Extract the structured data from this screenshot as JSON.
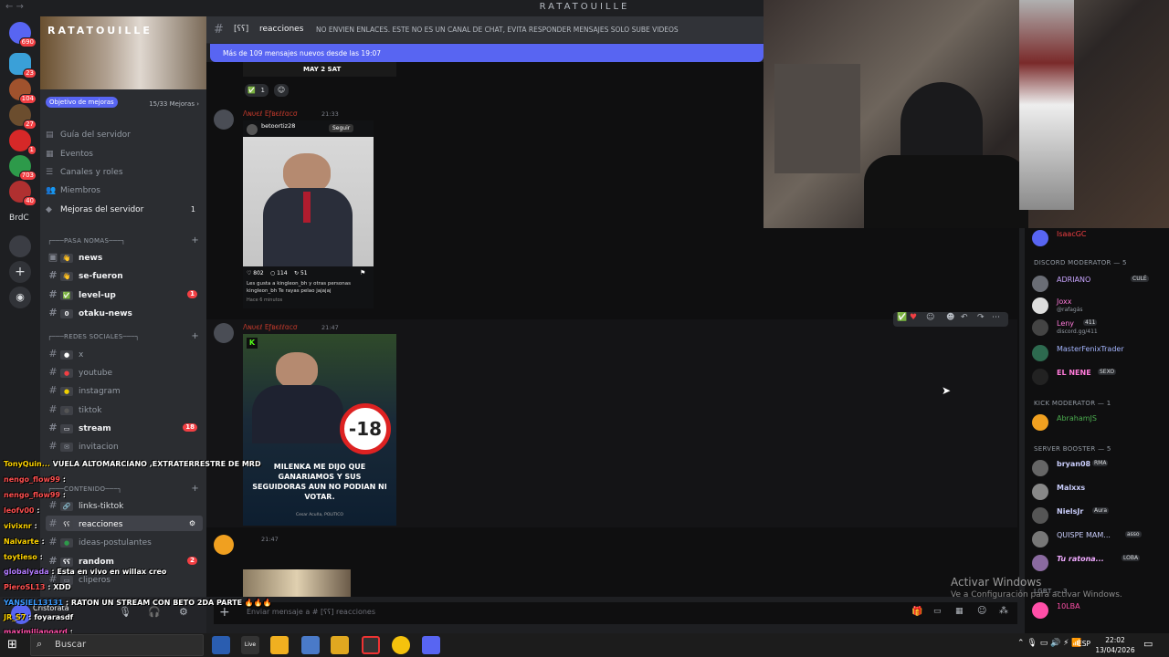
{
  "window": {
    "title": "RATATOUILLE",
    "nav": "←  →"
  },
  "server": {
    "name": "RATATOUILLE",
    "goal_label": "Objetivo de mejoras",
    "goal_count": "15/33 Mejoras ›"
  },
  "rail": {
    "badges": [
      "690",
      "23",
      "104",
      "27",
      "1",
      "703",
      "40"
    ],
    "label_brdc": "BrdC"
  },
  "server_menu": [
    {
      "label": "Guía del servidor"
    },
    {
      "label": "Eventos"
    },
    {
      "label": "Canales y roles"
    },
    {
      "label": "Miembros"
    },
    {
      "label": "Mejoras del servidor",
      "count": "1"
    }
  ],
  "categories": {
    "pasa": "┌───PASA NOMAS───┐",
    "redes": "┌───REDES SOCIALES───┐",
    "contenido": "┌───CONTENIDO───┐"
  },
  "channels": [
    {
      "name": "news",
      "emoji": "👋"
    },
    {
      "name": "se-fueron",
      "emoji": "👋"
    },
    {
      "name": "level-up",
      "emoji": "✅",
      "badge": "1"
    },
    {
      "name": "otaku-news",
      "emoji": "0"
    },
    {
      "name": "x"
    },
    {
      "name": "youtube"
    },
    {
      "name": "instagram"
    },
    {
      "name": "tiktok"
    },
    {
      "name": "stream",
      "badge": "18"
    },
    {
      "name": "invitacion"
    },
    {
      "name": "links-tiktok"
    },
    {
      "name": "reacciones"
    },
    {
      "name": "ideas-postulantes"
    },
    {
      "name": "random",
      "badge": "2"
    },
    {
      "name": "cliperos"
    }
  ],
  "header": {
    "channel": "reacciones",
    "bracket": "[ʕʕ]",
    "topic": "NO ENVIEN ENLACES. ESTE NO ES UN CANAL DE CHAT, EVITA RESPONDER MENSAJES SOLO SUBE VIDEOS"
  },
  "new_messages": "Más de 109 mensajes nuevos desde las 19:07",
  "messages": [
    {
      "author": "Λɴυєℓ Eƒʙєℓℓαcσ",
      "time": "21:33",
      "embed_user": "betoortiz28",
      "follow": "Seguir",
      "likes": "802",
      "comments": "114",
      "shares": "51",
      "caption": "Les gusta a kingleon_bh y otras personas",
      "caption2": "kingleon_bh Te rayas pelao jajajaj",
      "ago": "Hace 6 minutos"
    },
    {
      "author": "Λɴυєℓ Eƒʙєℓℓαcσ",
      "time": "21:47",
      "headline": "MILENKA ME DIJO QUE GANARIAMOS Y SUS SEGUIDORAS AUN NO PODIAN NI VOTAR.",
      "sign": "-18",
      "credit": "Cesar Acuña, POLITICO"
    },
    {
      "author": "",
      "time": "21:47"
    }
  ],
  "prev_msg": {
    "date": "MAY 2 SAT",
    "reaction_count": "1"
  },
  "composer": {
    "placeholder": "Enviar mensaje a #  [ʕʕ]  reacciones"
  },
  "members": {
    "top": {
      "name": "IsaacGC"
    },
    "cat1": "DISCORD MODERATOR — 5",
    "list1": [
      {
        "name": "ADRIANO",
        "tag": "CULÉ",
        "color": "#c9a5ff"
      },
      {
        "name": "Joxx",
        "sub": "@rafagás",
        "color": "#ff7ad9"
      },
      {
        "name": "Leny",
        "tag": "411",
        "sub": "discord.gg/411",
        "color": "#ff7ad9"
      },
      {
        "name": "MasterFenixTrader",
        "color": "#a5b6ff"
      },
      {
        "name": "EL NENE",
        "tag": "SEXO",
        "color": "#ff7ad9"
      }
    ],
    "cat2": "KICK MODERATOR — 1",
    "list2": [
      {
        "name": "AbrahamJS",
        "color": "#4caf50"
      }
    ],
    "cat3": "SERVER BOOSTER — 5",
    "list3": [
      {
        "name": "bryan08",
        "tag": "RMA",
        "color": "#c9cdfb"
      },
      {
        "name": "Malxxs",
        "color": "#c9cdfb"
      },
      {
        "name": "NielsJr",
        "tag": "Aura",
        "color": "#c9cdfb"
      },
      {
        "name": "QUISPE MAM...",
        "tag": "asso",
        "color": "#c9cdfb"
      },
      {
        "name": "Tu ratona...",
        "tag": "LOBA",
        "color": "#f0aaff"
      }
    ],
    "cat4": "LGBT — 3",
    "list4": [
      {
        "name": "10LBA",
        "color": "#ff4fa8"
      }
    ]
  },
  "stream_chat": [
    {
      "user": "TonyQuin...",
      "text": "VUELA ALTOMARCIANO ,EXTRATERRESTRE DE MRD",
      "color": "#ffd400"
    },
    {
      "user": "nengo_flow99",
      "text": ":",
      "color": "#ff4f4f"
    },
    {
      "user": "nengo_flow99",
      "text": ":",
      "color": "#ff4f4f"
    },
    {
      "user": "leofv00",
      "text": ":",
      "color": "#ff4f4f"
    },
    {
      "user": "vivixnr",
      "text": ":",
      "color": "#ffd400"
    },
    {
      "user": "Nalvarte",
      "text": ":",
      "color": "#ffd400"
    },
    {
      "user": "toytieso",
      "text": ":",
      "color": "#ffd400"
    },
    {
      "user": "globalyada",
      "text": ": Esta en vivo en willax creo",
      "color": "#b27aff"
    },
    {
      "user": "PieroSL13",
      "text": ": XDD",
      "color": "#ff4f4f"
    },
    {
      "user": "YANSIEL13131",
      "text": ": RATON UN STREAM CON BETO 2DA PARTE 🔥🔥🔥",
      "color": "#3b9bff"
    },
    {
      "user": "JR_S7",
      "text": ": foyarasdf",
      "color": "#ffd400"
    },
    {
      "user": "maximilianoard",
      "text": ":",
      "color": "#ff4fa8"
    }
  ],
  "user_panel": {
    "name": "Cristoratá"
  },
  "taskbar": {
    "search": "Buscar",
    "lang": "ESP",
    "time": "22:02",
    "date": "13/04/2026"
  },
  "watermark": {
    "line1": "Activar Windows",
    "line2": "Ve a Configuración para activar Windows."
  }
}
